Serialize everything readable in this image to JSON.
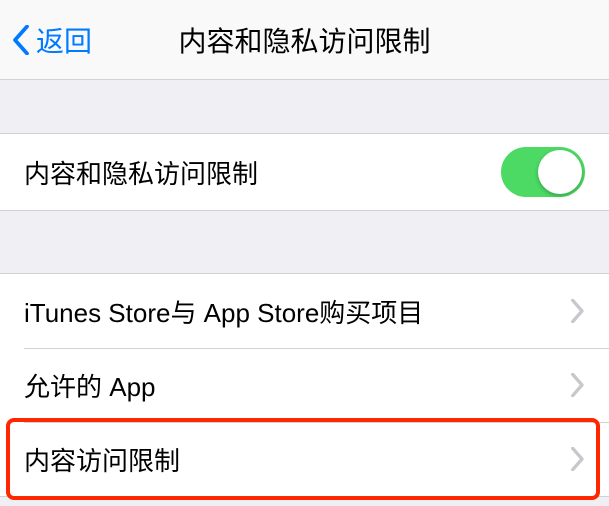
{
  "nav": {
    "back_label": "返回",
    "title": "内容和隐私访问限制"
  },
  "toggle_section": {
    "label": "内容和隐私访问限制",
    "on": true
  },
  "rows": [
    {
      "label": "iTunes Store与 App Store购买项目"
    },
    {
      "label": "允许的 App"
    },
    {
      "label": "内容访问限制"
    }
  ]
}
